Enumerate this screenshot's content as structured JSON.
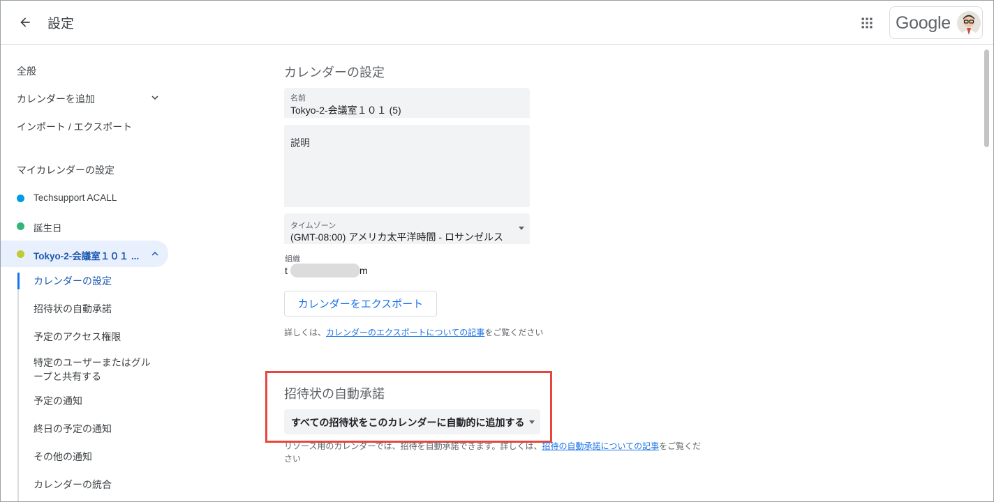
{
  "header": {
    "title": "設定",
    "brand": "Google"
  },
  "sidebar": {
    "top_items": [
      {
        "label": "全般"
      },
      {
        "label": "カレンダーを追加"
      },
      {
        "label": "インポート / エクスポート"
      }
    ],
    "my_calendars_heading": "マイカレンダーの設定",
    "calendars": [
      {
        "label": "Techsupport ACALL",
        "color": "#039be5"
      },
      {
        "label": "誕生日",
        "color": "#33b679"
      },
      {
        "label": "Tokyo-2-会議室１０１ ...",
        "color": "#c0ca33"
      }
    ],
    "sub_items": [
      {
        "label": "カレンダーの設定"
      },
      {
        "label": "招待状の自動承諾"
      },
      {
        "label": "予定のアクセス権限"
      },
      {
        "label": "特定のユーザーまたはグループと共有する"
      },
      {
        "label": "予定の通知"
      },
      {
        "label": "終日の予定の通知"
      },
      {
        "label": "その他の通知"
      },
      {
        "label": "カレンダーの統合"
      }
    ]
  },
  "main": {
    "calendar_settings": {
      "title": "カレンダーの設定",
      "name_label": "名前",
      "name_value": "Tokyo-2-会議室１０１ (5)",
      "description_label": "説明",
      "timezone_label": "タイムゾーン",
      "timezone_value": "(GMT-08:00) アメリカ太平洋時間 - ロサンゼルス",
      "org_label": "組織",
      "org_value_prefix": "t",
      "org_value_suffix": "m",
      "export_button": "カレンダーをエクスポート",
      "export_help_prefix": "詳しくは、",
      "export_help_link": "カレンダーのエクスポートについての記事",
      "export_help_suffix": "をご覧ください"
    },
    "auto_accept": {
      "title": "招待状の自動承諾",
      "select_value": "すべての招待状をこのカレンダーに自動的に追加する",
      "help_prefix": "リソース用のカレンダーでは、招待を自動承諾できます。詳しくは、",
      "help_link": "招待の自動承諾についての記事",
      "help_suffix": "をご覧くだ",
      "help_wrap": "さい"
    }
  },
  "colors": {
    "accent": "#1a73e8",
    "highlight": "#e8453c",
    "active_bg": "#e8f0fe"
  }
}
